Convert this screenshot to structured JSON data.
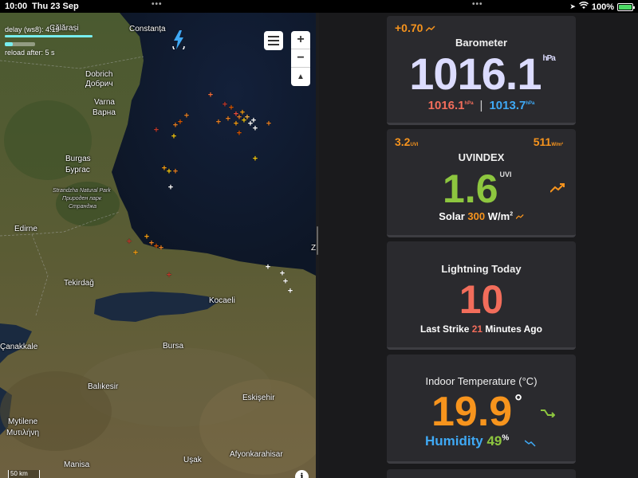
{
  "status_bar": {
    "time": "10:00",
    "date": "Thu 23 Sep",
    "battery": "100%"
  },
  "map": {
    "delay_text": "delay (ws8): 4.1s",
    "reload_text": "reload after: 5 s",
    "scale_text": "50 km",
    "info_label": "i",
    "labels": {
      "calarasi": "Călărași",
      "constanta": "Constanța",
      "dobrich": "Dobrich",
      "dobrich_cyr": "Добрич",
      "varna": "Varna",
      "varna_cyr": "Варна",
      "burgas": "Burgas",
      "burgas_cyr": "Бургас",
      "strandzha": "Strandzha Natural Park",
      "strandzha_cyr": "Природен парк",
      "strandzha_cyr2": "Странджа",
      "edirne": "Edirne",
      "tekirdag": "Tekirdağ",
      "kocaeli": "Kocaeli",
      "canakkale": "Çanakkale",
      "bursa": "Bursa",
      "eskisehir": "Eskişehir",
      "balikesir": "Balıkesir",
      "mytilene": "Mytilene",
      "mytilene_gr": "Μυτιλήνη",
      "manisa": "Manisa",
      "usak": "Uşak",
      "afyon": "Afyonkarahisar",
      "z": "Z"
    }
  },
  "barometer": {
    "delta": "+0.70",
    "title": "Barometer",
    "value": "1016.1",
    "unit": "hPa",
    "low": "1016.1",
    "low_unit": "hPa",
    "separator": "|",
    "high": "1013.7",
    "high_unit": "hPa"
  },
  "uv": {
    "uv_max": "3.2",
    "uv_max_unit": "UVI",
    "solar_max": "511",
    "solar_max_unit": "W/m²",
    "title": "UVINDEX",
    "value": "1.6",
    "unit": "UVI",
    "solar_label": "Solar",
    "solar_value": "300",
    "solar_unit": "W/m",
    "solar_unit_sup": "2"
  },
  "lightning": {
    "title": "Lightning Today",
    "count": "10",
    "last_prefix": "Last Strike",
    "last_value": "21",
    "last_suffix": "Minutes Ago"
  },
  "indoor": {
    "title": "Indoor Temperature (°C)",
    "value": "19.9",
    "deg": "°",
    "humidity_label": "Humidity",
    "humidity_value": "49",
    "humidity_unit": "%"
  },
  "colors": {
    "orange": "#f7941d",
    "blue": "#3fa9f5",
    "green": "#8dc63f",
    "salmon": "#f26d5b",
    "card_bg": "#2a2a2e"
  }
}
